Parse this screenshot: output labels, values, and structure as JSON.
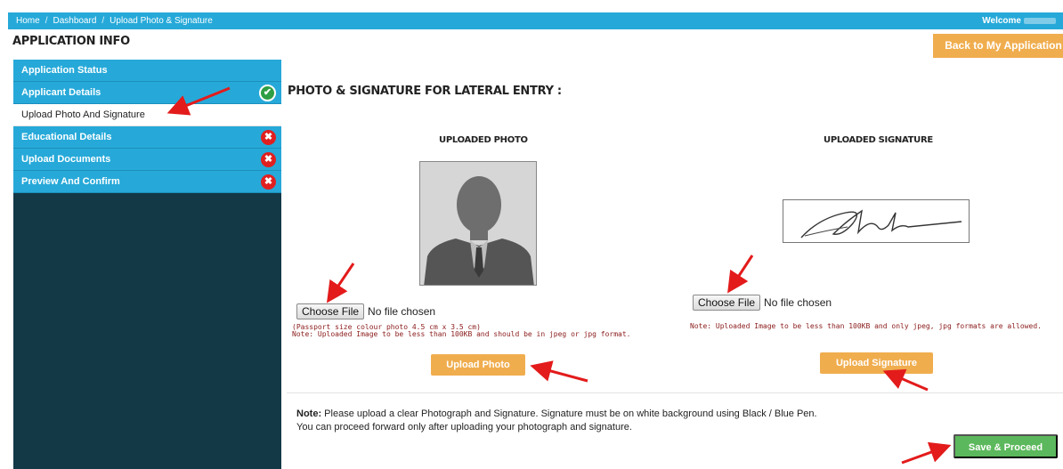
{
  "breadcrumb": {
    "home": "Home",
    "dashboard": "Dashboard",
    "current": "Upload Photo & Signature"
  },
  "header": {
    "welcome": "Welcome"
  },
  "page": {
    "title": "APPLICATION INFO",
    "back_button": "Back to My Application"
  },
  "sidebar": {
    "items": [
      {
        "label": "Application Status",
        "status": ""
      },
      {
        "label": "Applicant Details",
        "status": "✔"
      },
      {
        "label": "Upload Photo And Signature",
        "status": ""
      },
      {
        "label": "Educational Details",
        "status": "✖"
      },
      {
        "label": "Upload Documents",
        "status": "✖"
      },
      {
        "label": "Preview And Confirm",
        "status": "✖"
      }
    ]
  },
  "main": {
    "section_title": "PHOTO & SIGNATURE FOR LATERAL ENTRY :",
    "photo": {
      "title": "UPLOADED PHOTO",
      "choose_file": "Choose File",
      "file_status": "No file chosen",
      "size_note": "(Passport size colour photo 4.5 cm x 3.5 cm)",
      "note": "Note: Uploaded Image to be less than 100KB and should be in jpeg or jpg format.",
      "upload_button": "Upload Photo"
    },
    "signature": {
      "title": "UPLOADED SIGNATURE",
      "choose_file": "Choose File",
      "file_status": "No file chosen",
      "note": "Note: Uploaded Image to be less than 100KB and only jpeg, jpg formats are allowed.",
      "upload_button": "Upload Signature"
    },
    "footer_note": {
      "label": "Note:",
      "line1": "Please upload a clear Photograph and Signature. Signature must be on white background using Black / Blue Pen.",
      "line2": "You can proceed forward only after uploading your photograph and signature."
    },
    "save_button": "Save & Proceed"
  },
  "colors": {
    "primary": "#26a9d9",
    "sidebar_bg": "#133947",
    "warning": "#f0ad4e",
    "success": "#5cb85c",
    "error": "#e02020",
    "note_red": "#8b1a1a",
    "arrow": "#e31b1b"
  }
}
